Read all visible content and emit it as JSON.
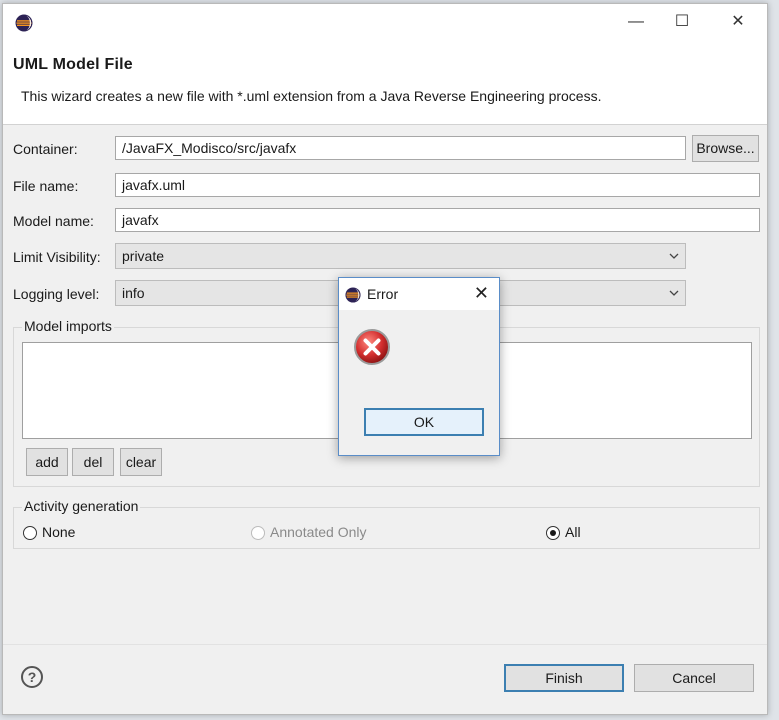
{
  "window": {
    "title_bar_buttons": {
      "minimize": "—",
      "maximize": "☐",
      "close": "✕"
    }
  },
  "header": {
    "title": "UML Model File",
    "description": "This wizard creates a new file with *.uml extension from a Java Reverse Engineering process."
  },
  "form": {
    "container_label": "Container:",
    "container_value": "/JavaFX_Modisco/src/javafx",
    "browse_label": "Browse...",
    "file_name_label": "File name:",
    "file_name_value": "javafx.uml",
    "model_name_label": "Model name:",
    "model_name_value": "javafx",
    "limit_visibility_label": "Limit Visibility:",
    "limit_visibility_value": "private",
    "logging_level_label": "Logging level:",
    "logging_level_value": "info"
  },
  "model_imports": {
    "title": "Model imports",
    "add_label": "add",
    "del_label": "del",
    "clear_label": "clear"
  },
  "activity_generation": {
    "title": "Activity generation",
    "options": [
      {
        "label": "None",
        "checked": false,
        "disabled": false
      },
      {
        "label": "Annotated Only",
        "checked": false,
        "disabled": true
      },
      {
        "label": "All",
        "checked": true,
        "disabled": false
      }
    ]
  },
  "footer": {
    "help_symbol": "?",
    "finish_label": "Finish",
    "cancel_label": "Cancel"
  },
  "error_dialog": {
    "title": "Error",
    "close_symbol": "✕",
    "ok_label": "OK"
  },
  "colors": {
    "accent_border": "#3c7fb1",
    "error_red": "#d32f2f"
  }
}
